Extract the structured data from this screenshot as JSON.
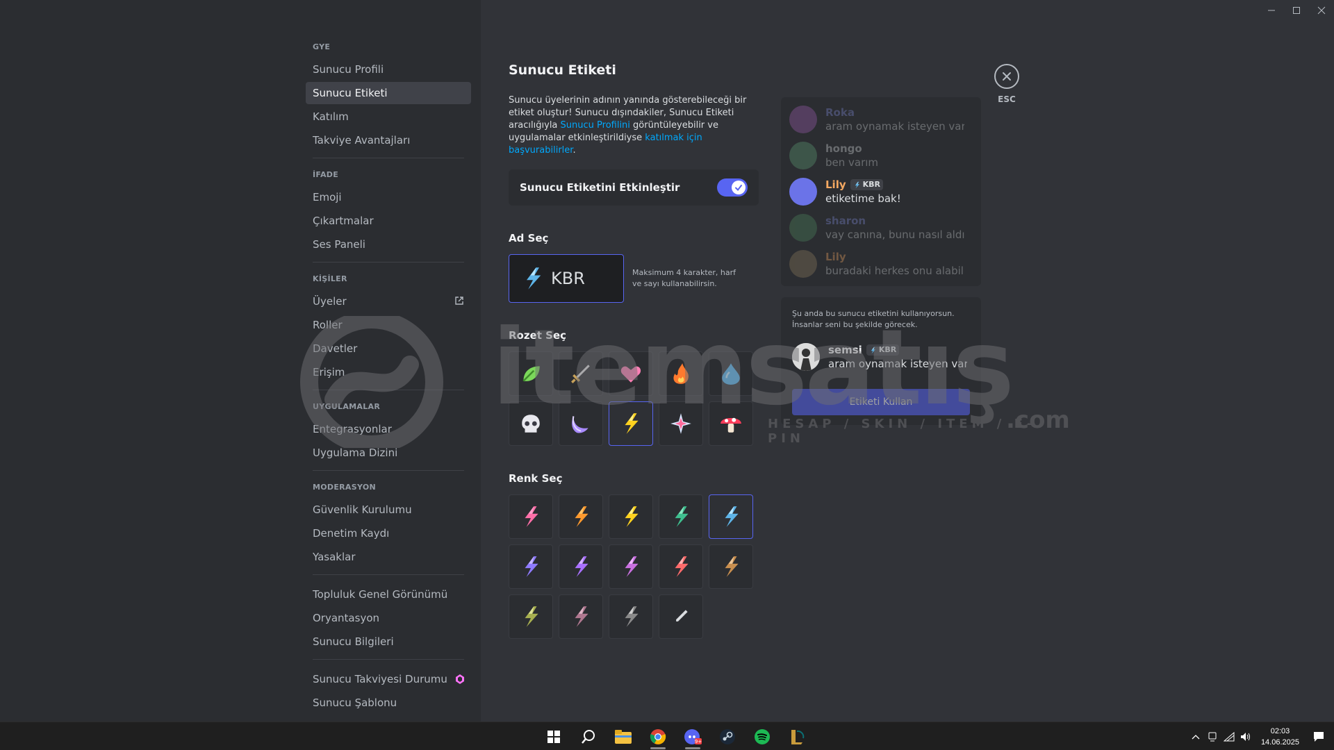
{
  "window": {
    "minimize_label": "Minimize",
    "maximize_label": "Maximize",
    "close_label": "Close"
  },
  "sidebar": {
    "sections": [
      {
        "header": "GYE",
        "items": [
          "Sunucu Profili",
          "Sunucu Etiketi",
          "Katılım",
          "Takviye Avantajları"
        ]
      },
      {
        "header": "İFADE",
        "items": [
          "Emoji",
          "Çıkartmalar",
          "Ses Paneli"
        ]
      },
      {
        "header": "KİŞİLER",
        "items": [
          "Üyeler",
          "Roller",
          "Davetler",
          "Erişim"
        ]
      },
      {
        "header": "UYGULAMALAR",
        "items": [
          "Entegrasyonlar",
          "Uygulama Dizini"
        ]
      },
      {
        "header": "MODERASYON",
        "items": [
          "Güvenlik Kurulumu",
          "Denetim Kaydı",
          "Yasaklar"
        ]
      },
      {
        "header": "",
        "items": [
          "Topluluk Genel Görünümü",
          "Oryantasyon",
          "Sunucu Bilgileri"
        ]
      },
      {
        "header": "",
        "items": [
          "Sunucu Takviyesi Durumu",
          "Sunucu Şablonu"
        ]
      }
    ],
    "active_item": "Sunucu Etiketi"
  },
  "main": {
    "title": "Sunucu Etiketi",
    "desc_part1": "Sunucu üyelerinin adının yanında gösterebileceği bir etiket oluştur! Sunucu dışındakiler, Sunucu Etiketi aracılığıyla ",
    "desc_link1": "Sunucu Profilini",
    "desc_part2": " görüntüleyebilir ve uygulamalar etkinleştirildiyse ",
    "desc_link2": "katılmak için başvurabilirler",
    "desc_part3": ".",
    "toggle_label": "Sunucu Etiketini Etkinleştir",
    "toggle_on": true,
    "name_section": "Ad Seç",
    "name_value": "KBR",
    "name_help": "Maksimum 4 karakter, harf ve sayı kullanabilirsin.",
    "badge_section": "Rozet Seç",
    "badges": [
      "leaf",
      "sword",
      "heart",
      "fire",
      "water",
      "skull",
      "moon",
      "lightning",
      "sparkle",
      "mushroom"
    ],
    "selected_badge": "lightning",
    "color_section": "Renk Seç",
    "colors": [
      [
        "#ff6fa8",
        "#ffa1cb"
      ],
      [
        "#ff9a2e",
        "#ffc46b"
      ],
      [
        "#ffd21f",
        "#fff08a"
      ],
      [
        "#3fbf8f",
        "#8ee6c2"
      ],
      [
        "#5eb4e8",
        "#b8e6ff"
      ],
      [
        "#8f7bff",
        "#c7b8ff"
      ],
      [
        "#a970ff",
        "#d4b3ff"
      ],
      [
        "#c970e0",
        "#f0b8ff"
      ],
      [
        "#ff6b6b",
        "#ffb3b3"
      ],
      [
        "#c98f4f",
        "#ecc79a"
      ],
      [
        "#a8b050",
        "#dfe39a"
      ],
      [
        "#b07890",
        "#e0b8c8"
      ],
      [
        "#8a8a8a",
        "#d0d0d0"
      ]
    ],
    "selected_color_index": 4
  },
  "preview": {
    "esc_label": "ESC",
    "messages": [
      {
        "name": "Roka",
        "text": "aram oynamak isteyen var mı",
        "tag": false,
        "dim": true,
        "name_color": "#7f8ad6",
        "avatar": "#a05fb5"
      },
      {
        "name": "hongo",
        "text": "ben varım",
        "tag": false,
        "dim": true,
        "name_color": "#dbdee1",
        "avatar": "#5fa077"
      },
      {
        "name": "Lily",
        "text": "etiketime bak!",
        "tag": true,
        "tag_text": "KBR",
        "dim": false,
        "name_color": "#f5a962",
        "avatar": "#6b73e8"
      },
      {
        "name": "sharon",
        "text": "vay canına, bunu nasıl aldın?",
        "tag": false,
        "dim": true,
        "name_color": "#7f8ad6",
        "avatar": "#4f8a5f"
      },
      {
        "name": "Lily",
        "text": "buradaki herkes onu alabilir!",
        "tag": false,
        "dim": true,
        "name_color": "#f5a962",
        "avatar": "#8f7d5f"
      }
    ],
    "using_text": "Şu anda bu sunucu etiketini kullanıyorsun. İnsanlar seni bu şekilde görecek.",
    "self_name": "semsi",
    "self_tag": "KBR",
    "self_text": "aram oynamak isteyen var mı",
    "use_button": "Etiketi Kullan"
  },
  "watermark": {
    "brand": "itemsatış",
    "sub": "HESAP / SKIN / ITEM / E-PIN",
    "com": ".com"
  },
  "taskbar": {
    "apps": [
      "start-icon",
      "search-icon",
      "explorer-icon",
      "chrome-icon",
      "discord-icon",
      "steam-icon",
      "spotify-icon",
      "league-icon"
    ],
    "time": "02:03",
    "date": "14.06.2025"
  }
}
